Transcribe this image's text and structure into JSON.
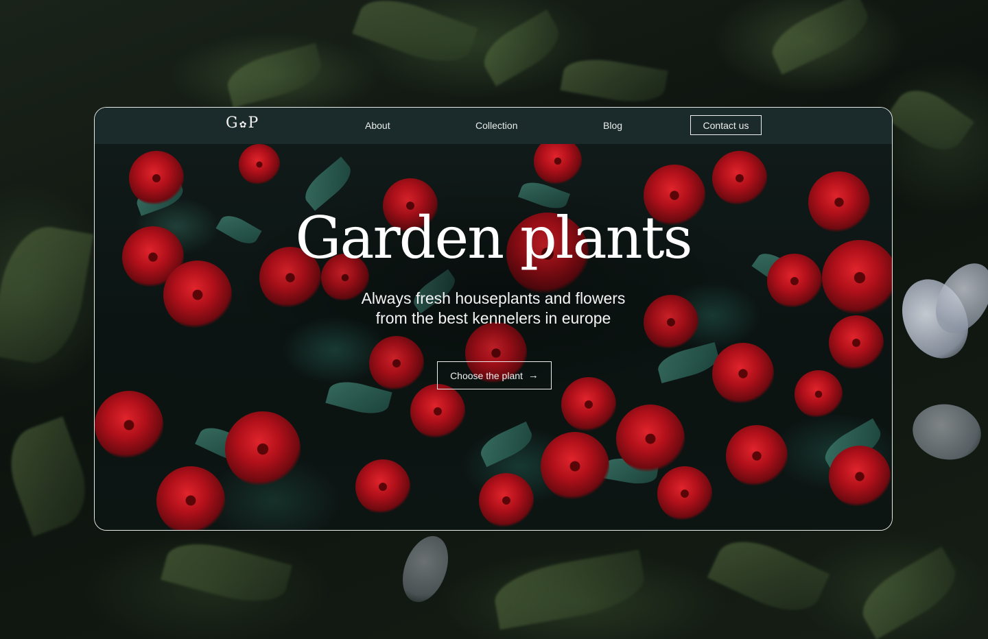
{
  "nav": {
    "logo_left": "G",
    "logo_mark": "✿",
    "logo_right": "P",
    "links": [
      {
        "label": "About"
      },
      {
        "label": "Collection"
      },
      {
        "label": "Blog"
      }
    ],
    "contact_label": "Contact us"
  },
  "hero": {
    "title": "Garden plants",
    "subtitle_line1": "Always fresh houseplants and flowers",
    "subtitle_line2": "from the best kennelers in europe",
    "cta_label": "Choose the plant",
    "cta_icon": "arrow-right-icon",
    "cta_arrow": "→"
  },
  "colors": {
    "navbar_bg": "#1b2a2a",
    "text": "#ffffff",
    "rose_red": "#c0141e",
    "leaf_green": "#2f6a5c"
  }
}
